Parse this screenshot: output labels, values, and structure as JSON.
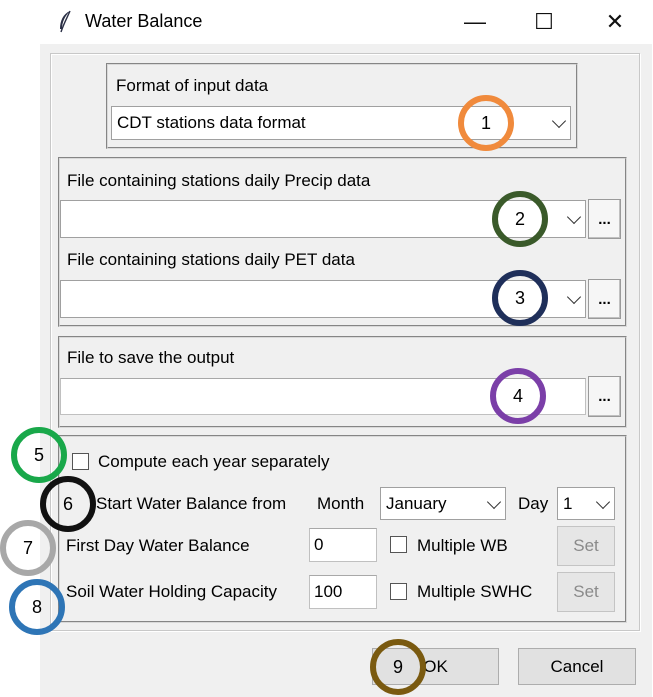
{
  "window": {
    "title": "Water Balance",
    "controls": {
      "minimize": "—",
      "maximize": "☐",
      "close": "✕"
    }
  },
  "input_format": {
    "label": "Format of input data",
    "selected": "CDT stations data format"
  },
  "station_files": {
    "precip_label": "File containing stations daily Precip data",
    "precip_value": "",
    "pet_label": "File containing stations daily PET data",
    "pet_value": "",
    "browse_label": "..."
  },
  "output": {
    "label": "File to save the output",
    "value": "",
    "browse_label": "..."
  },
  "options": {
    "compute_each_year_label": "Compute each year separately",
    "compute_each_year_checked": false,
    "start_label": "Start Water Balance from",
    "month_label": "Month",
    "month_value": "January",
    "day_label": "Day",
    "day_value": "1",
    "first_day_label": "First Day Water Balance",
    "first_day_value": "0",
    "multiple_wb_label": "Multiple WB",
    "multiple_wb_checked": false,
    "swhc_label": "Soil Water Holding Capacity",
    "swhc_value": "100",
    "multiple_swhc_label": "Multiple SWHC",
    "multiple_swhc_checked": false,
    "set_label": "Set"
  },
  "footer": {
    "ok_label": "OK",
    "cancel_label": "Cancel"
  },
  "callouts": [
    {
      "number": "1",
      "color": "#f08a3c"
    },
    {
      "number": "2",
      "color": "#3a5a2a"
    },
    {
      "number": "3",
      "color": "#1f2f5a"
    },
    {
      "number": "4",
      "color": "#7b3fa8"
    },
    {
      "number": "5",
      "color": "#19a84a"
    },
    {
      "number": "6",
      "color": "#111111"
    },
    {
      "number": "7",
      "color": "#a8a8a8"
    },
    {
      "number": "8",
      "color": "#2e75b6"
    },
    {
      "number": "9",
      "color": "#7a5a10"
    }
  ],
  "icons": {
    "app_icon": "feather-icon",
    "dropdown": "chevron-down-icon"
  }
}
